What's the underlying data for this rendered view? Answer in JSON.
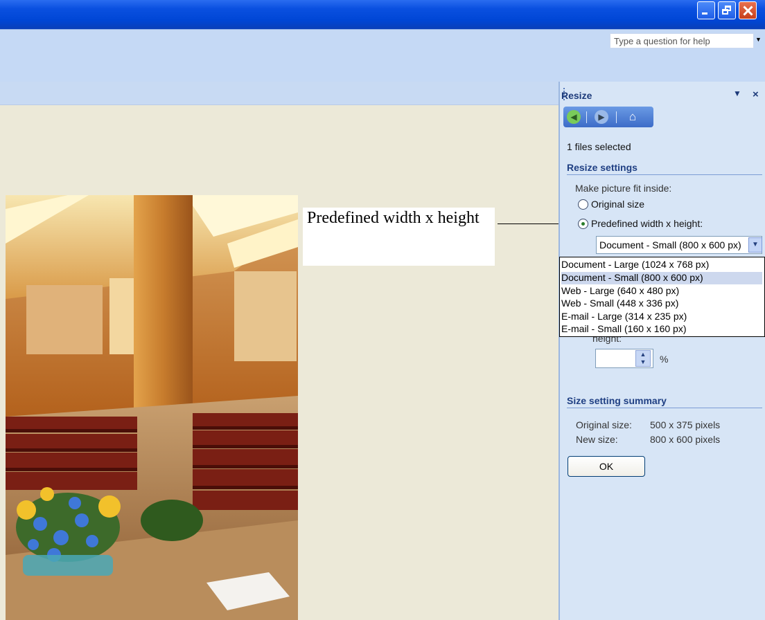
{
  "window": {
    "help_placeholder": "Type a question for help"
  },
  "task_pane": {
    "title": "Resize",
    "files_selected": "1 files selected",
    "resize_settings_heading": "Resize settings",
    "fit_label": "Make picture fit inside:",
    "option_original": "Original size",
    "option_predefined": "Predefined width x height:",
    "select_value": "Document - Small (800 x 600 px)",
    "dropdown_options": [
      "Document - Large (1024 x 768 px)",
      "Document - Small (800 x 600 px)",
      "Web - Large (640 x 480 px)",
      "Web - Small (448 x 336 px)",
      "E-mail - Large (314 x 235 px)",
      "E-mail - Small (160 x 160 px)"
    ],
    "height_label": "height:",
    "percent_symbol": "%",
    "summary_heading": "Size setting summary",
    "original_size_label": "Original size:",
    "original_size_value": "500 x 375 pixels",
    "new_size_label": "New size:",
    "new_size_value": "800 x 600 pixels",
    "ok_label": "OK"
  },
  "callout": {
    "text": "Predefined width x height"
  },
  "colors": {
    "titlebar": "#0046d5",
    "pane_background": "#d7e5f6",
    "heading": "#1f3f83"
  }
}
